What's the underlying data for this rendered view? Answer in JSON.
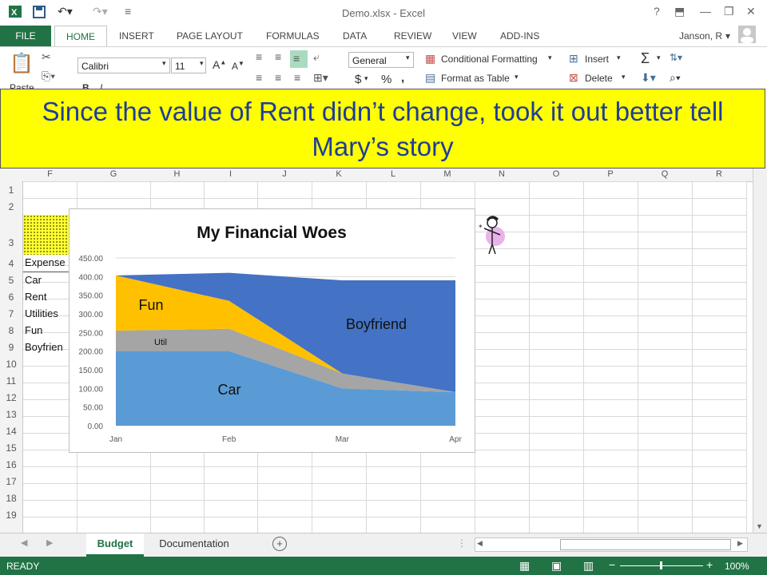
{
  "window": {
    "title": "Demo.xlsx - Excel",
    "help": "?",
    "user": "Janson, R"
  },
  "ribbon_tabs": [
    "FILE",
    "HOME",
    "INSERT",
    "PAGE LAYOUT",
    "FORMULAS",
    "DATA",
    "REVIEW",
    "VIEW",
    "ADD-INS"
  ],
  "ribbon": {
    "font_name": "Calibri",
    "font_size": "11",
    "number_format": "General",
    "paste_label": "Paste",
    "conditional_formatting": "Conditional Formatting",
    "format_as_table": "Format as Table",
    "insert": "Insert",
    "delete": "Delete",
    "currency": "$",
    "percent": "%"
  },
  "callout": {
    "text": "Since the value of Rent didn’t change, took it out better tell Mary’s story"
  },
  "columns": [
    "F",
    "G",
    "H",
    "I",
    "J",
    "K",
    "L",
    "M",
    "N",
    "O",
    "P",
    "Q",
    "R"
  ],
  "rows": [
    "1",
    "2",
    "3",
    "4",
    "5",
    "6",
    "7",
    "8",
    "9",
    "10",
    "11",
    "12",
    "13",
    "14",
    "15",
    "16",
    "17",
    "18",
    "19"
  ],
  "cells": [
    "Expense",
    "Car",
    "Rent",
    "Utilities",
    "Fun",
    "Boyfrien"
  ],
  "chart_data": {
    "type": "area",
    "title": "My Financial Woes",
    "categories": [
      "Jan",
      "Feb",
      "Mar",
      "Apr"
    ],
    "stacked": true,
    "ylim": [
      0,
      450
    ],
    "y_ticks": [
      "0.00",
      "50.00",
      "100.00",
      "150.00",
      "200.00",
      "250.00",
      "300.00",
      "350.00",
      "400.00",
      "450.00"
    ],
    "series": [
      {
        "name": "Car",
        "values": [
          200,
          200,
          100,
          90
        ],
        "color": "#5b9bd5"
      },
      {
        "name": "Util",
        "values": [
          55,
          60,
          40,
          0
        ],
        "color": "#a5a5a5"
      },
      {
        "name": "Fun",
        "values": [
          148,
          75,
          0,
          0
        ],
        "color": "#ffc000"
      },
      {
        "name": "Boyfriend",
        "values": [
          0,
          75,
          250,
          300
        ],
        "color": "#4472c4"
      }
    ],
    "gridlines": true
  },
  "sheet_tabs": [
    "Budget",
    "Documentation"
  ],
  "status": {
    "ready": "READY",
    "zoom": "100%"
  }
}
